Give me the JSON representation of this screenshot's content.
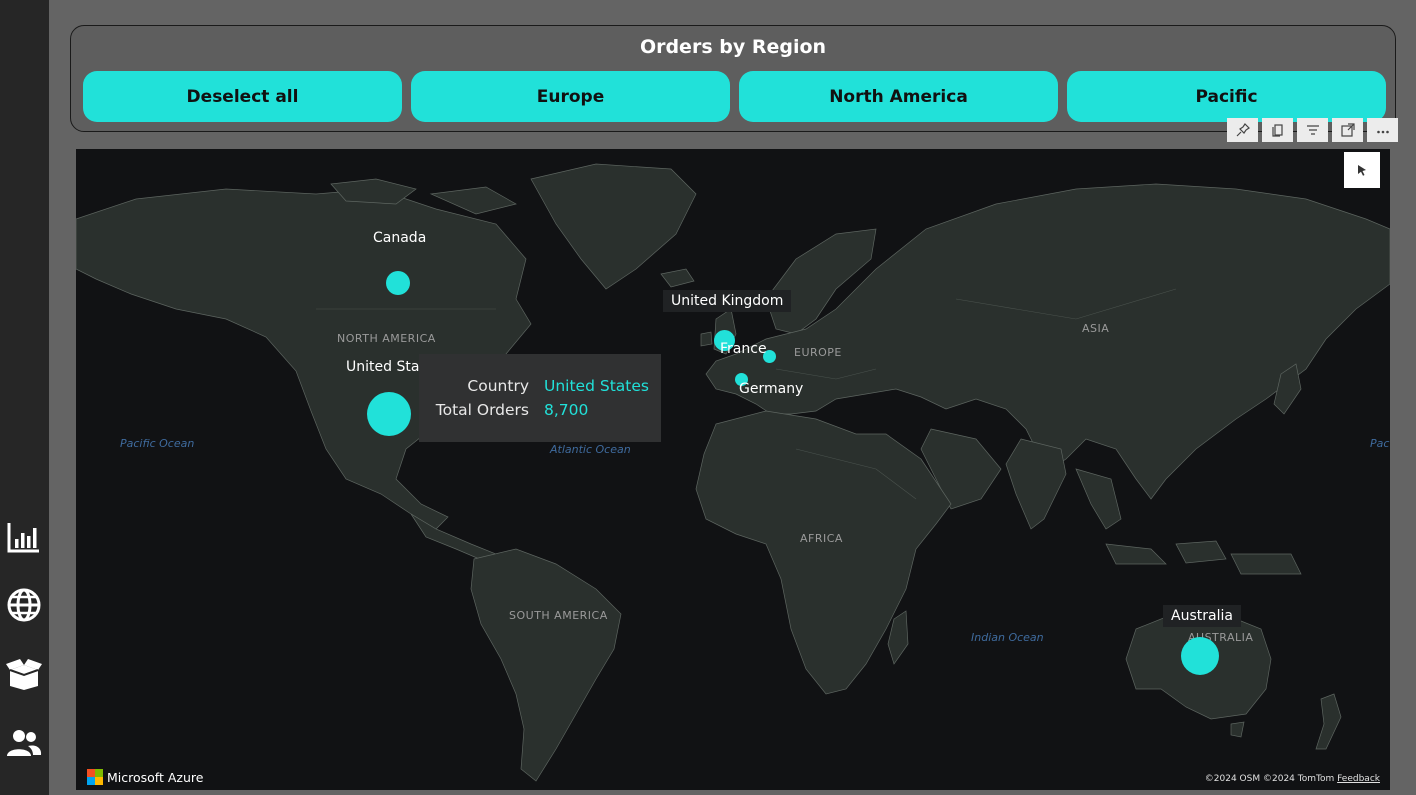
{
  "sidebar": {
    "items": [
      {
        "icon": "bar-chart-icon"
      },
      {
        "icon": "globe-icon"
      },
      {
        "icon": "box-icon"
      },
      {
        "icon": "people-icon"
      }
    ]
  },
  "slicer": {
    "title": "Orders by Region",
    "buttons": [
      "Deselect all",
      "Europe",
      "North America",
      "Pacific"
    ],
    "accent_color": "#21e1d9"
  },
  "toolbar": {
    "icons": [
      "pin-icon",
      "copy-icon",
      "filter-icon",
      "focus-mode-icon",
      "more-options-icon"
    ]
  },
  "map": {
    "continents": [
      "NORTH AMERICA",
      "SOUTH AMERICA",
      "EUROPE",
      "AFRICA",
      "ASIA",
      "AUSTRALIA"
    ],
    "oceans": [
      "Pacific Ocean",
      "Atlantic Ocean",
      "Indian Ocean",
      "Pac"
    ],
    "countries": [
      {
        "name": "Canada"
      },
      {
        "name": "United Stat"
      },
      {
        "name": "United Kingdom"
      },
      {
        "name": "France"
      },
      {
        "name": "Germany"
      },
      {
        "name": "Australia"
      }
    ],
    "tooltip": {
      "country_label": "Country",
      "country_value": "United States",
      "orders_label": "Total Orders",
      "orders_value": "8,700"
    },
    "brand": "Microsoft Azure",
    "attribution_osm": "©2024 OSM",
    "attribution_tomtom": "©2024 TomTom",
    "feedback": "Feedback"
  }
}
